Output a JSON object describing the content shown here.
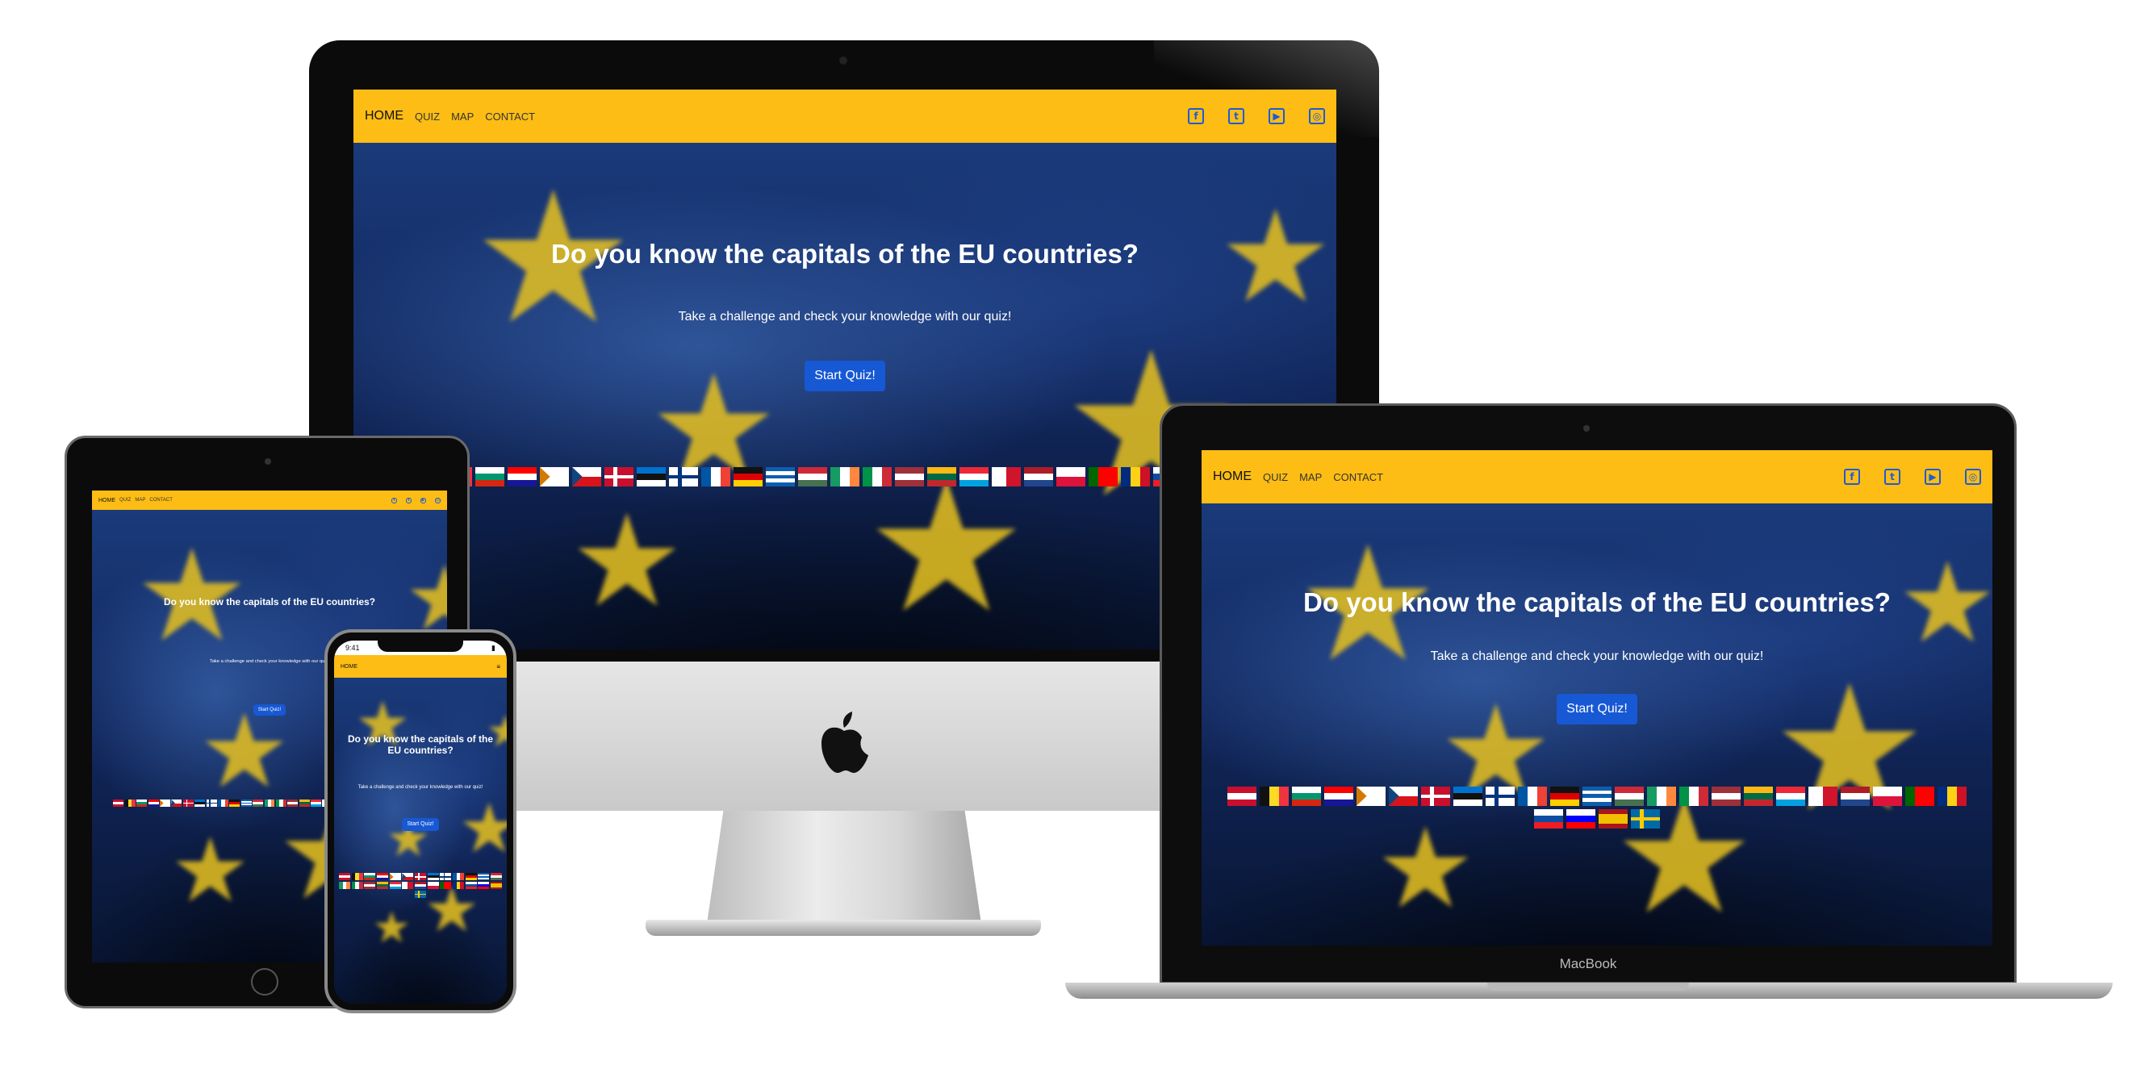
{
  "site": {
    "nav": {
      "home": "HOME",
      "quiz": "QUIZ",
      "map": "MAP",
      "contact": "CONTACT"
    },
    "social": [
      {
        "icon": "facebook-icon",
        "glyph": "f"
      },
      {
        "icon": "twitter-icon",
        "glyph": "t"
      },
      {
        "icon": "youtube-icon",
        "glyph": "▶"
      },
      {
        "icon": "instagram-icon",
        "glyph": "◎"
      }
    ],
    "hero_title": "Do you know the capitals of the EU countries?",
    "hero_subtitle": "Take a challenge and check your knowledge with our quiz!",
    "cta_label": "Start Quiz!",
    "flags": [
      {
        "code": "AT",
        "stripes": "h",
        "colors": [
          "#c8102e",
          "#ffffff",
          "#c8102e"
        ]
      },
      {
        "code": "BE",
        "stripes": "v",
        "colors": [
          "#111111",
          "#fdda24",
          "#ef3340"
        ]
      },
      {
        "code": "BG",
        "stripes": "h",
        "colors": [
          "#ffffff",
          "#00966e",
          "#d62612"
        ]
      },
      {
        "code": "HR",
        "stripes": "h",
        "colors": [
          "#ff0000",
          "#ffffff",
          "#171796"
        ]
      },
      {
        "code": "CY",
        "stripes": "h",
        "colors": [
          "#ffffff",
          "#ffffff",
          "#ffffff"
        ],
        "mark": "#d57800"
      },
      {
        "code": "CZ",
        "stripes": "h",
        "colors": [
          "#ffffff",
          "#d7141a"
        ],
        "mark": "#11457e"
      },
      {
        "code": "DK",
        "stripes": "x",
        "colors": [
          "#c8102e",
          "#ffffff"
        ]
      },
      {
        "code": "EE",
        "stripes": "h",
        "colors": [
          "#0072ce",
          "#111111",
          "#ffffff"
        ]
      },
      {
        "code": "FI",
        "stripes": "x",
        "colors": [
          "#ffffff",
          "#003580"
        ]
      },
      {
        "code": "FR",
        "stripes": "v",
        "colors": [
          "#0055a4",
          "#ffffff",
          "#ef4135"
        ]
      },
      {
        "code": "DE",
        "stripes": "h",
        "colors": [
          "#111111",
          "#dd0000",
          "#ffce00"
        ]
      },
      {
        "code": "GR",
        "stripes": "h",
        "colors": [
          "#0d5eaf",
          "#ffffff",
          "#0d5eaf",
          "#ffffff",
          "#0d5eaf"
        ]
      },
      {
        "code": "HU",
        "stripes": "h",
        "colors": [
          "#ce2939",
          "#ffffff",
          "#477050"
        ]
      },
      {
        "code": "IE",
        "stripes": "v",
        "colors": [
          "#169b62",
          "#ffffff",
          "#ff883e"
        ]
      },
      {
        "code": "IT",
        "stripes": "v",
        "colors": [
          "#009246",
          "#ffffff",
          "#ce2b37"
        ]
      },
      {
        "code": "LV",
        "stripes": "h",
        "colors": [
          "#9e3039",
          "#ffffff",
          "#9e3039"
        ]
      },
      {
        "code": "LT",
        "stripes": "h",
        "colors": [
          "#fdb913",
          "#006a44",
          "#c1272d"
        ]
      },
      {
        "code": "LU",
        "stripes": "h",
        "colors": [
          "#ed2939",
          "#ffffff",
          "#00a1de"
        ]
      },
      {
        "code": "MT",
        "stripes": "v",
        "colors": [
          "#ffffff",
          "#cf142b"
        ]
      },
      {
        "code": "NL",
        "stripes": "h",
        "colors": [
          "#ae1c28",
          "#ffffff",
          "#21468b"
        ]
      },
      {
        "code": "PL",
        "stripes": "h",
        "colors": [
          "#ffffff",
          "#dc143c"
        ]
      },
      {
        "code": "PT",
        "stripes": "v",
        "colors": [
          "#006600",
          "#ff0000",
          "#ff0000"
        ]
      },
      {
        "code": "RO",
        "stripes": "v",
        "colors": [
          "#002b7f",
          "#fcd116",
          "#ce1126"
        ]
      },
      {
        "code": "SK",
        "stripes": "h",
        "colors": [
          "#ffffff",
          "#0b4ea2",
          "#ee1c25"
        ]
      },
      {
        "code": "SI",
        "stripes": "h",
        "colors": [
          "#ffffff",
          "#0000ff",
          "#ff0000"
        ]
      },
      {
        "code": "ES",
        "stripes": "h",
        "colors": [
          "#aa151b",
          "#f1bf00",
          "#f1bf00",
          "#aa151b"
        ]
      },
      {
        "code": "SE",
        "stripes": "x",
        "colors": [
          "#006aa7",
          "#fecc00"
        ]
      }
    ]
  },
  "phone_status": {
    "time": "9:41"
  },
  "macbook_label": "MacBook",
  "colors": {
    "nav_bg": "#fdbd14",
    "cta_bg": "#1758d4",
    "icon_blue": "#1e5bd6"
  }
}
